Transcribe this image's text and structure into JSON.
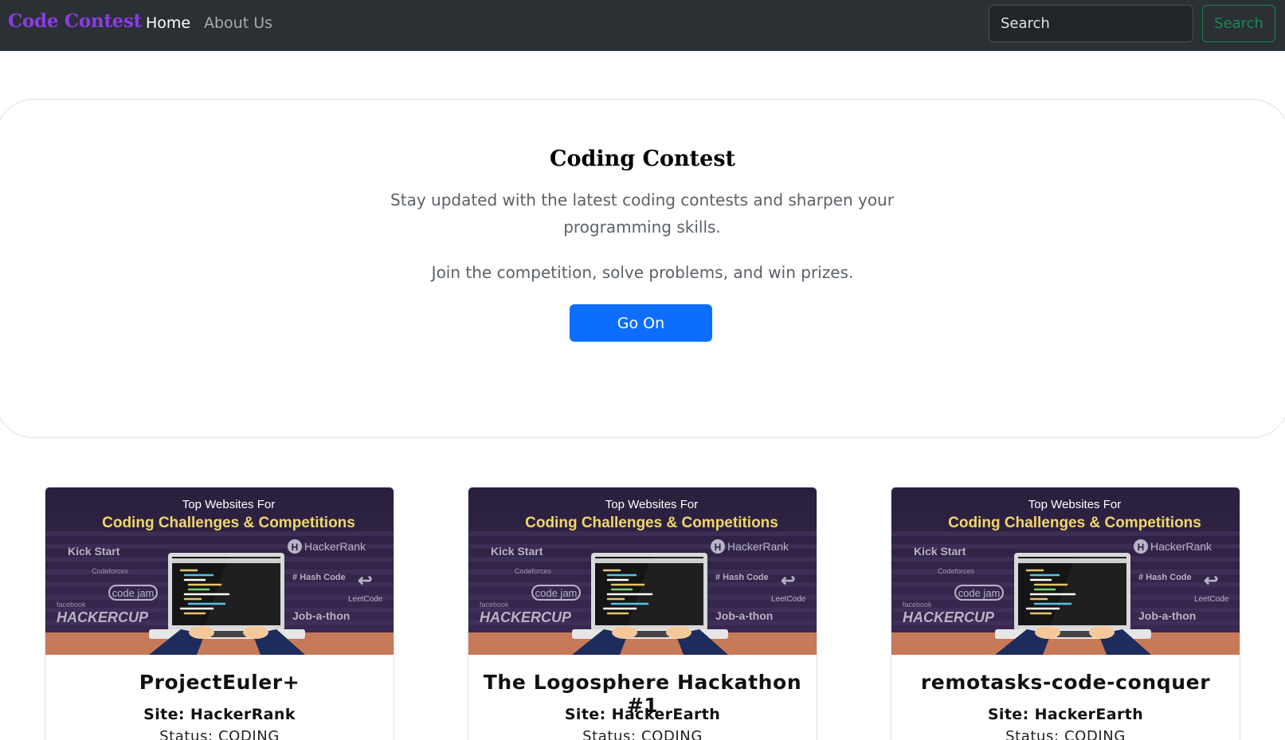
{
  "navbar": {
    "brand": "Code Contest",
    "links": [
      {
        "label": "Home",
        "active": true
      },
      {
        "label": "About Us",
        "active": false
      }
    ],
    "search_placeholder": "Search",
    "search_button": "Search"
  },
  "hero": {
    "title": "Coding Contest",
    "lead": "Stay updated with the latest coding contests and sharpen your programming skills.",
    "sub": "Join the competition, solve problems, and win prizes.",
    "button": "Go On"
  },
  "banner": {
    "line1": "Top Websites For",
    "line2": "Coding Challenges & Competitions",
    "logos": [
      "Kick Start",
      "HackerRank",
      "Codeforces",
      "code jam",
      "# Hash Code",
      "LeetCode",
      "facebook",
      "HACKERCUP",
      "Job-a-thon"
    ]
  },
  "cards": [
    {
      "title": "ProjectEuler+",
      "site": "Site: HackerRank",
      "status": "Status: CODING"
    },
    {
      "title": "The Logosphere Hackathon #1",
      "site": "Site: HackerEarth",
      "status": "Status: CODING"
    },
    {
      "title": "remotasks-code-conquer",
      "site": "Site: HackerEarth",
      "status": "Status: CODING"
    }
  ],
  "colors": {
    "navbar": "#2b3035",
    "brand": "#8a3ce6",
    "primary": "#0d6efd",
    "success": "#198754"
  }
}
